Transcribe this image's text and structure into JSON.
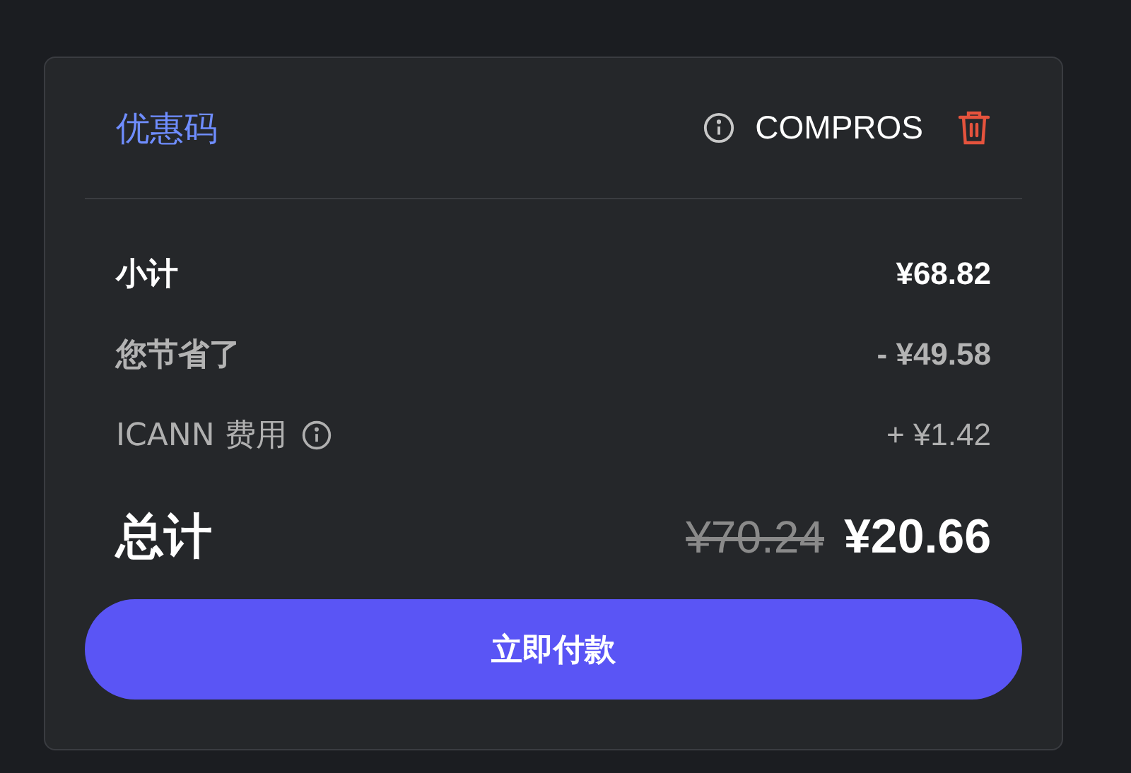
{
  "promo": {
    "label": "优惠码",
    "code": "COMPROS"
  },
  "rows": [
    {
      "kind": "strong",
      "label": "小计",
      "value": "¥68.82",
      "info": false
    },
    {
      "kind": "muted",
      "label": "您节省了",
      "value": "- ¥49.58",
      "info": false
    },
    {
      "kind": "plain",
      "label": "ICANN 费用",
      "value": "+ ¥1.42",
      "info": true
    }
  ],
  "total": {
    "label": "总计",
    "original": "¥70.24",
    "final": "¥20.66"
  },
  "pay_button": "立即付款"
}
